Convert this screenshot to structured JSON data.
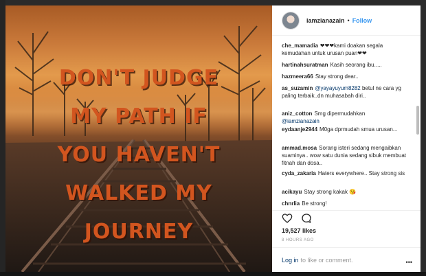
{
  "post": {
    "quote_lines": [
      "DON'T JUDGE",
      "MY PATH IF",
      "YOU HAVEN'T",
      "WALKED MY",
      "JOURNEY"
    ]
  },
  "header": {
    "username": "iamzianazain",
    "separator": "•",
    "follow_label": "Follow"
  },
  "comments": [
    {
      "user": "che_mamadia",
      "text": "❤❤❤kami doakan segala kemudahan untuk urusan puan❤❤"
    },
    {
      "user": "hartinahsuratman",
      "text": "Kasih seorang ibu....."
    },
    {
      "user": "hazmeera66",
      "text": "Stay strong dear.."
    },
    {
      "user": "as_suzamin",
      "mention": "@yayayuyum8282",
      "text": "betul ne cara yg paling terbaik..dn muhasabah diri.."
    },
    {
      "user": "aniz_cotton",
      "text": "Smg dipermudahkan",
      "mention_after": "@iamzianazain"
    },
    {
      "user": "eydaanje2944",
      "text": "M0ga dprmudah smua urusan..."
    },
    {
      "user": "ammad.mosa",
      "text": "Sorang isteri sedang mengaibkan suaminya.. wow satu dunia sedang sibuk membuat fitnah dan dosa.."
    },
    {
      "user": "cyda_zakaria",
      "text": "Haters everywhere.. Stay strong sis"
    },
    {
      "user": "acikayu",
      "text": "Stay strong kakak 😘"
    },
    {
      "user": "chnrlia",
      "text": "Be strong!"
    }
  ],
  "actions": {
    "like_icon": "heart-icon",
    "comment_icon": "comment-bubble-icon"
  },
  "likes": "19,527 likes",
  "timestamp": "8 HOURS AGO",
  "footer": {
    "login_link": "Log in",
    "login_rest": "to like or comment.",
    "more_label": "•••"
  }
}
